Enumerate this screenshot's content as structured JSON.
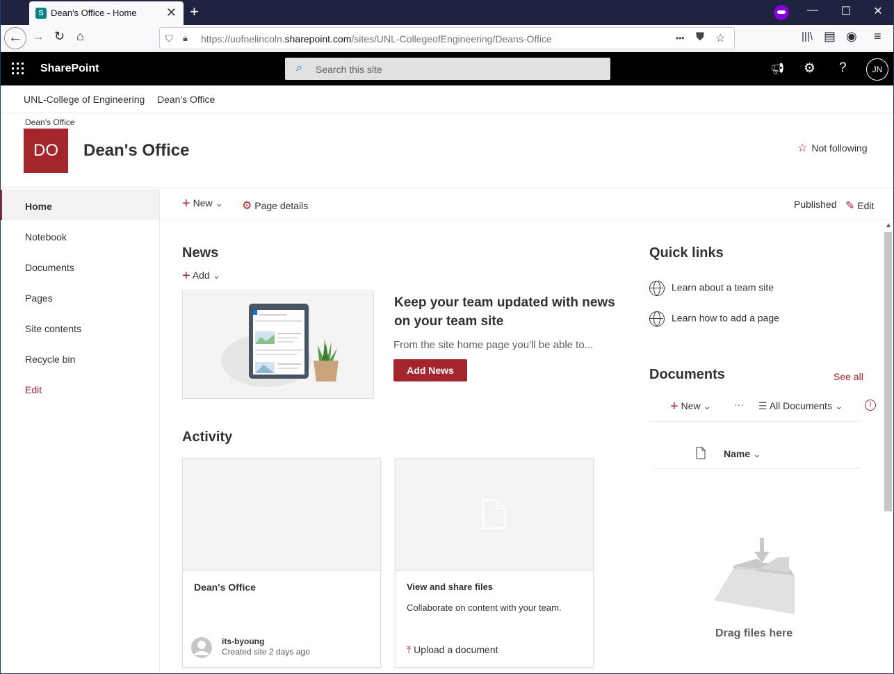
{
  "browser": {
    "tab_title": "Dean's Office - Home",
    "tab_favicon_letter": "S",
    "url_prefix": "https://uofnelincoln.",
    "url_domain": "sharepoint.com",
    "url_path": "/sites/UNL-CollegeofEngineering/Deans-Office",
    "more_icon": "•••"
  },
  "suite": {
    "brand": "SharePoint",
    "search_placeholder": "Search this site",
    "user_initials": "JN"
  },
  "hub": {
    "items": [
      "UNL-College of Engineering",
      "Dean's Office"
    ]
  },
  "site": {
    "breadcrumb": "Dean's Office",
    "logo_initials": "DO",
    "title": "Dean's Office",
    "follow_label": "Not following"
  },
  "leftnav": {
    "items": [
      "Home",
      "Notebook",
      "Documents",
      "Pages",
      "Site contents",
      "Recycle bin",
      "Edit"
    ]
  },
  "command_bar": {
    "new_label": "New",
    "page_details_label": "Page details",
    "status": "Published",
    "edit_label": "Edit"
  },
  "news": {
    "heading": "News",
    "add_label": "Add",
    "title": "Keep your team updated with news on your team site",
    "description": "From the site home page you'll be able to...",
    "button_label": "Add News"
  },
  "activity": {
    "heading": "Activity",
    "cards": [
      {
        "title": "Dean's Office",
        "author": "its-byoung",
        "meta": "Created site 2 days ago"
      },
      {
        "title": "View and share files",
        "description": "Collaborate on content with your team.",
        "action": "Upload a document"
      }
    ]
  },
  "quick_links": {
    "heading": "Quick links",
    "items": [
      "Learn about a team site",
      "Learn how to add a page"
    ]
  },
  "documents": {
    "heading": "Documents",
    "see_all": "See all",
    "new_label": "New",
    "more": "···",
    "view_label": "All Documents",
    "column_name": "Name",
    "empty_label": "Drag files here"
  },
  "colors": {
    "accent": "#a4262c",
    "suite_bar": "#000000",
    "tabstrip": "#202340"
  }
}
